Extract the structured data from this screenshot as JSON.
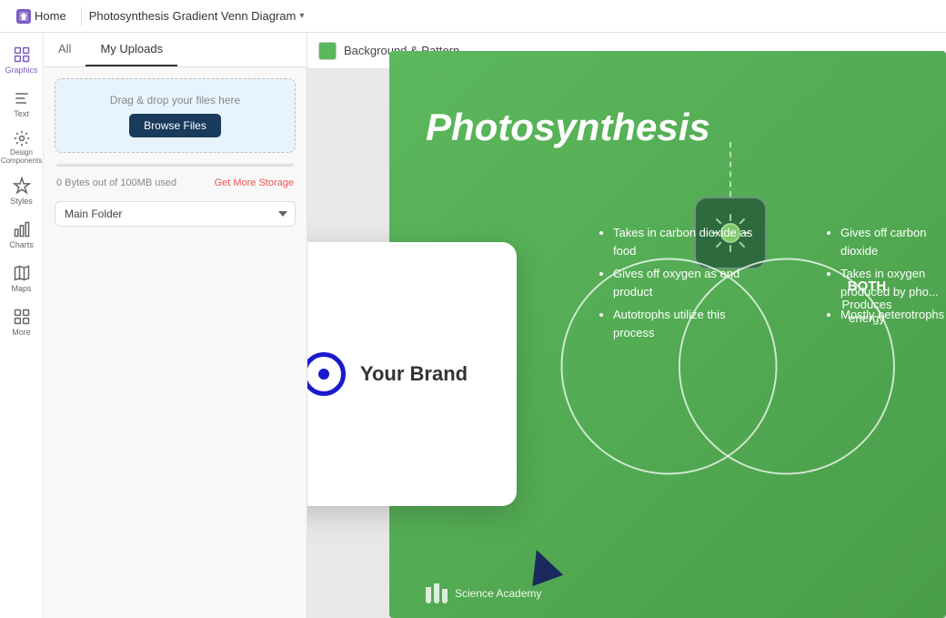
{
  "topbar": {
    "home_label": "Home",
    "title": "Photosynthesis Gradient Venn Diagram",
    "chevron": "▾"
  },
  "sidebar": {
    "items": [
      {
        "id": "graphics",
        "label": "Graphics",
        "active": true
      },
      {
        "id": "text",
        "label": "Text",
        "active": false
      },
      {
        "id": "design",
        "label": "Design Components",
        "active": false
      },
      {
        "id": "styles",
        "label": "Styles",
        "active": false
      },
      {
        "id": "charts",
        "label": "Charts",
        "active": false
      },
      {
        "id": "maps",
        "label": "Maps",
        "active": false
      },
      {
        "id": "more",
        "label": "More",
        "active": false
      }
    ]
  },
  "left_panel": {
    "tabs": [
      "All",
      "My Uploads"
    ],
    "active_tab": "My Uploads",
    "upload": {
      "drag_text": "Drag & drop your files here",
      "browse_label": "Browse Files"
    },
    "storage": {
      "used": "0 Bytes out of 100MB used",
      "get_more": "Get More Storage"
    },
    "folder": {
      "label": "Main Folder",
      "options": [
        "Main Folder"
      ]
    }
  },
  "canvas_top": {
    "pattern_label": "Background & Pattern"
  },
  "slide": {
    "title": "Photosynthesis",
    "left_circle": {
      "items": [
        "Takes in carbon dioxide as food",
        "Gives off oxygen as end product",
        "Autotrophs utilize this process"
      ]
    },
    "both": {
      "label": "BOTH",
      "sub": "Produces energy"
    },
    "right_circle": {
      "items": [
        "Gives off carbon dioxide",
        "Takes in oxygen produced by photosynthesis",
        "Mostly heterotrophs"
      ]
    },
    "footer": {
      "name": "Science Academy"
    }
  },
  "brand_card": {
    "name": "Your Brand"
  }
}
